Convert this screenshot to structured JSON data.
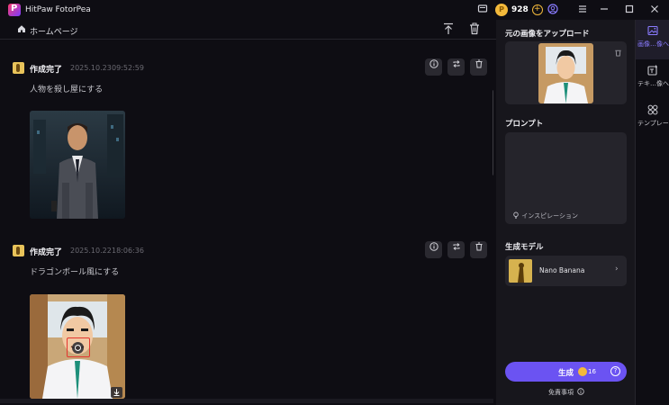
{
  "app": {
    "title": "HitPaw FotorPea"
  },
  "account": {
    "credits": "928"
  },
  "nav": {
    "home_label": "ホームページ"
  },
  "feed": {
    "cards": [
      {
        "status": "作成完了",
        "date": "2025.10.23",
        "time": "09:52:59",
        "prompt": "人物を殺し屋にする"
      },
      {
        "status": "作成完了",
        "date": "2025.10.22",
        "time": "18:06:36",
        "prompt": "ドラゴンボール風にする"
      }
    ]
  },
  "panel": {
    "upload_heading": "元の画像をアップロード",
    "prompt_heading": "プロンプト",
    "inspiration_label": "インスピレーション",
    "model_heading": "生成モデル",
    "model_name": "Nano Banana",
    "generate_label": "生成",
    "generate_cost": "16",
    "disclaimer": "免責事項"
  },
  "rail": {
    "items": [
      {
        "label": "画像…像へ",
        "icon": "image-to-image-icon",
        "active": true
      },
      {
        "label": "テキ…像へ",
        "icon": "text-to-image-icon",
        "active": false
      },
      {
        "label": "テンプレート",
        "icon": "template-icon",
        "active": false
      }
    ]
  },
  "colors": {
    "accent": "#6b53f2",
    "coin": "#f3b93b",
    "background": "#0e0d13",
    "panel": "#17161c"
  }
}
